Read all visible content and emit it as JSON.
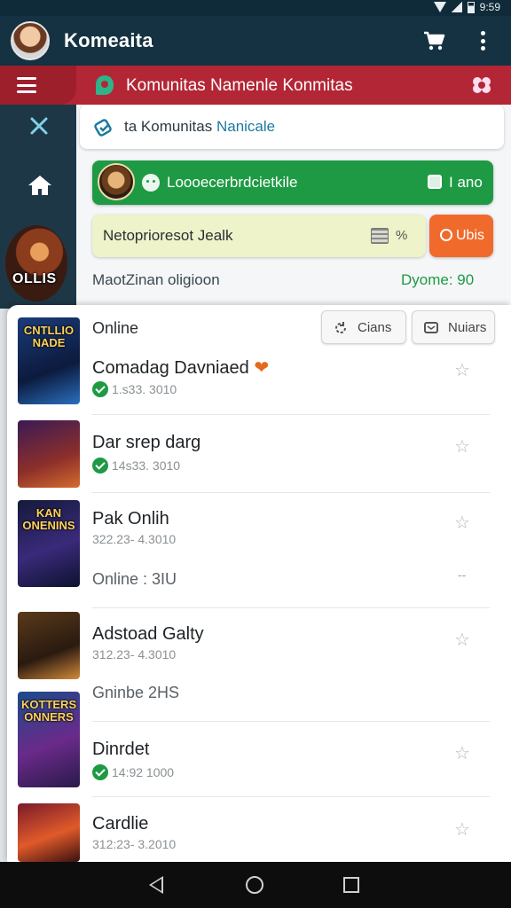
{
  "status_bar": {
    "time": "9:59"
  },
  "app_bar": {
    "title": "Komeaita"
  },
  "community_bar": {
    "title": "Komunitas Namenle Konmitas"
  },
  "left_rail": {
    "game_badge_text": "OLLIS"
  },
  "search": {
    "label_prefix": "ta Komunitas",
    "label_highlight": "Nanicale"
  },
  "green_row": {
    "text": "Loooecerbrdcietkile",
    "right_label": "I ano"
  },
  "yellow_row": {
    "text": "Netoprioresot Jealk",
    "percent": "%"
  },
  "orange_button": {
    "label": "Ubis"
  },
  "meta": {
    "left": "MaotZinan oligioon",
    "right": "Dyome: 90"
  },
  "sheet": {
    "label": "Online",
    "buttons": [
      {
        "label": "Cians"
      },
      {
        "label": "Nuiars"
      }
    ]
  },
  "list": [
    {
      "title": "Comadag Davniaed",
      "subtitle": "1.s33. 3010",
      "thumb_text": "CNTLLIO NADE",
      "status": "check"
    },
    {
      "title": "Dar srep darg",
      "subtitle": "14s33. 3010",
      "thumb_text": "",
      "status": "check"
    },
    {
      "title": "Pak Onlih",
      "subtitle": "322.23- 4.3010",
      "thumb_text": "KAN ONENINS",
      "online_text": "Online : 3IU",
      "dash": "--"
    },
    {
      "title": "Adstoad Galty",
      "subtitle": "312.23- 4.3010",
      "thumb_text": "",
      "online_text": "Gninbe 2HS"
    },
    {
      "title": "Dinrdet",
      "subtitle": "14:92 1000",
      "thumb_text": "KOTTERS ONNERS",
      "status": "check"
    },
    {
      "title": "Cardlie",
      "subtitle": "312:23- 3.2010",
      "thumb_text": ""
    }
  ],
  "colors": {
    "app_bar": "#143241",
    "red_bar": "#b32636",
    "green": "#1f9a44",
    "orange": "#f06a2c",
    "yellow_card": "#eef3c9"
  }
}
